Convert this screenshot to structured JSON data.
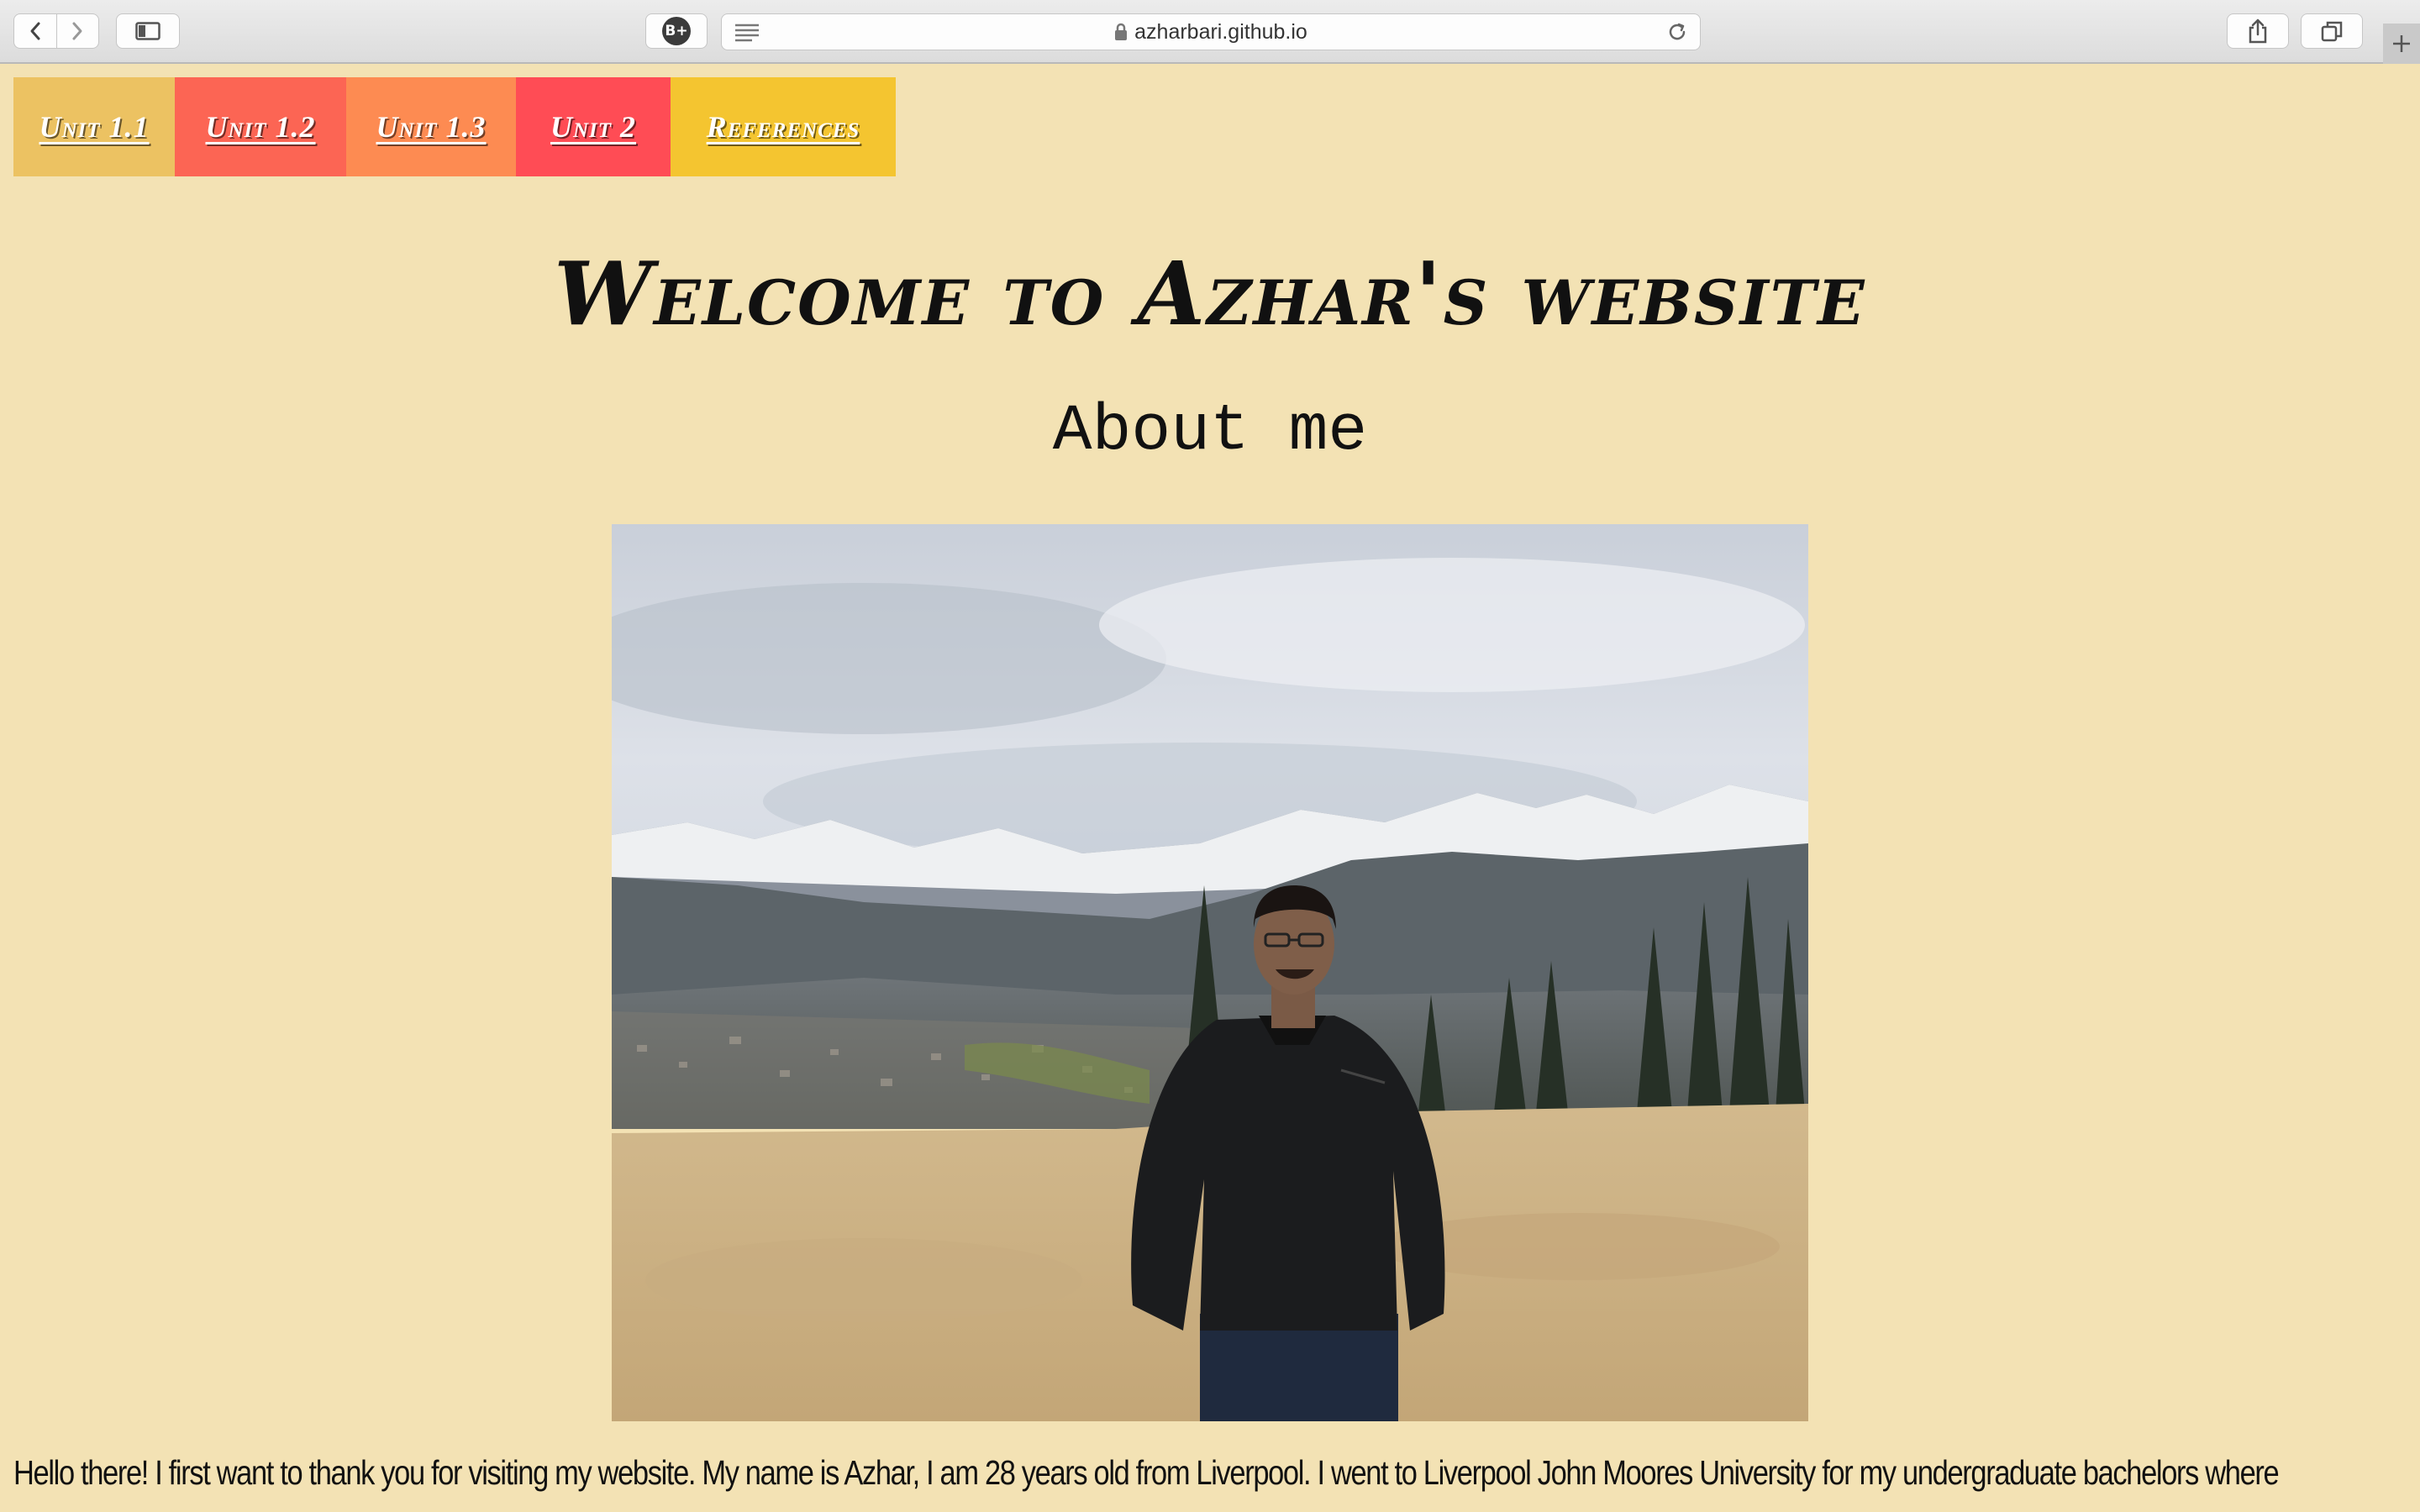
{
  "browser": {
    "url": "azharbari.github.io",
    "extension_badge": "B+"
  },
  "nav": {
    "items": [
      {
        "label": "Unit 1.1",
        "color": "#ecc262"
      },
      {
        "label": "Unit 1.2",
        "color": "#fc6554"
      },
      {
        "label": "Unit 1.3",
        "color": "#fd8b52"
      },
      {
        "label": "Unit 2",
        "color": "#ff4c55"
      },
      {
        "label": "References",
        "color": "#f4c530"
      }
    ]
  },
  "page": {
    "background": "#f3e2b4",
    "title": "Welcome to Azhar's website",
    "subtitle": "About me",
    "intro": "Hello there! I first want to thank you for visiting my website. My name is Azhar, I am 28 years old from Liverpool. I went to Liverpool John Moores University for my undergraduate bachelors where"
  },
  "icons": {
    "back": "chevron-left-icon",
    "forward": "chevron-right-icon",
    "sidebar": "sidebar-icon",
    "reader": "reader-lines-icon",
    "lock": "lock-icon",
    "reload": "reload-icon",
    "share": "share-icon",
    "tabs": "tabs-overview-icon",
    "new_tab": "plus-icon"
  }
}
